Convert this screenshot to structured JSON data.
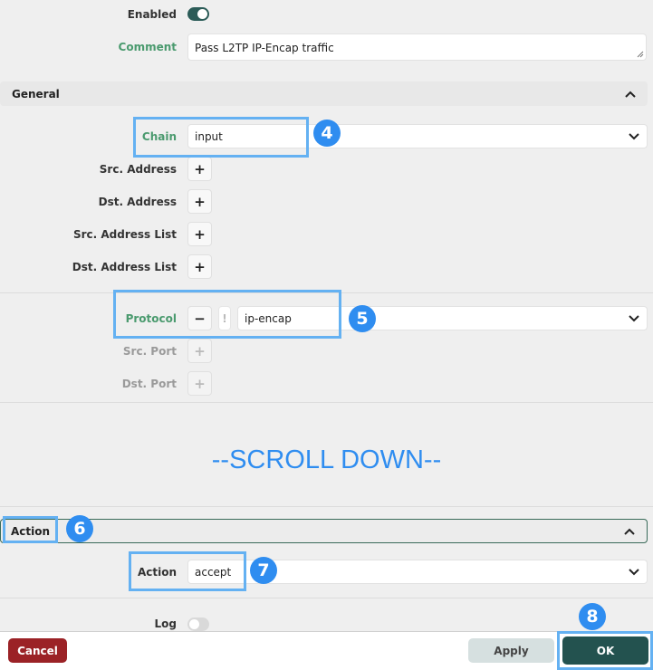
{
  "form": {
    "enabled_label": "Enabled",
    "enabled": true,
    "comment_label": "Comment",
    "comment_value": "Pass L2TP IP-Encap traffic"
  },
  "general": {
    "title": "General",
    "chain_label": "Chain",
    "chain_value": "input",
    "src_address_label": "Src. Address",
    "dst_address_label": "Dst. Address",
    "src_address_list_label": "Src. Address List",
    "dst_address_list_label": "Dst. Address List",
    "add_symbol": "+",
    "protocol_label": "Protocol",
    "protocol_value": "ip-encap",
    "remove_symbol": "−",
    "negate_symbol": "!",
    "src_port_label": "Src. Port",
    "dst_port_label": "Dst. Port"
  },
  "scroll_note": "--SCROLL DOWN--",
  "action_section": {
    "title": "Action",
    "action_label": "Action",
    "action_value": "accept",
    "log_label": "Log",
    "log_enabled": false
  },
  "footer": {
    "cancel_label": "Cancel",
    "apply_label": "Apply",
    "ok_label": "OK"
  },
  "annotations": {
    "step4": "4",
    "step5": "5",
    "step6": "6",
    "step7": "7",
    "step8": "8"
  },
  "colors": {
    "highlight": "#64b1f2",
    "badge": "#2f8df0",
    "toggle_on": "#2b5b57",
    "cancel": "#9b2226",
    "ok": "#23524f",
    "label_green": "#4a9a6e",
    "scroll_text": "#2f8df0"
  }
}
